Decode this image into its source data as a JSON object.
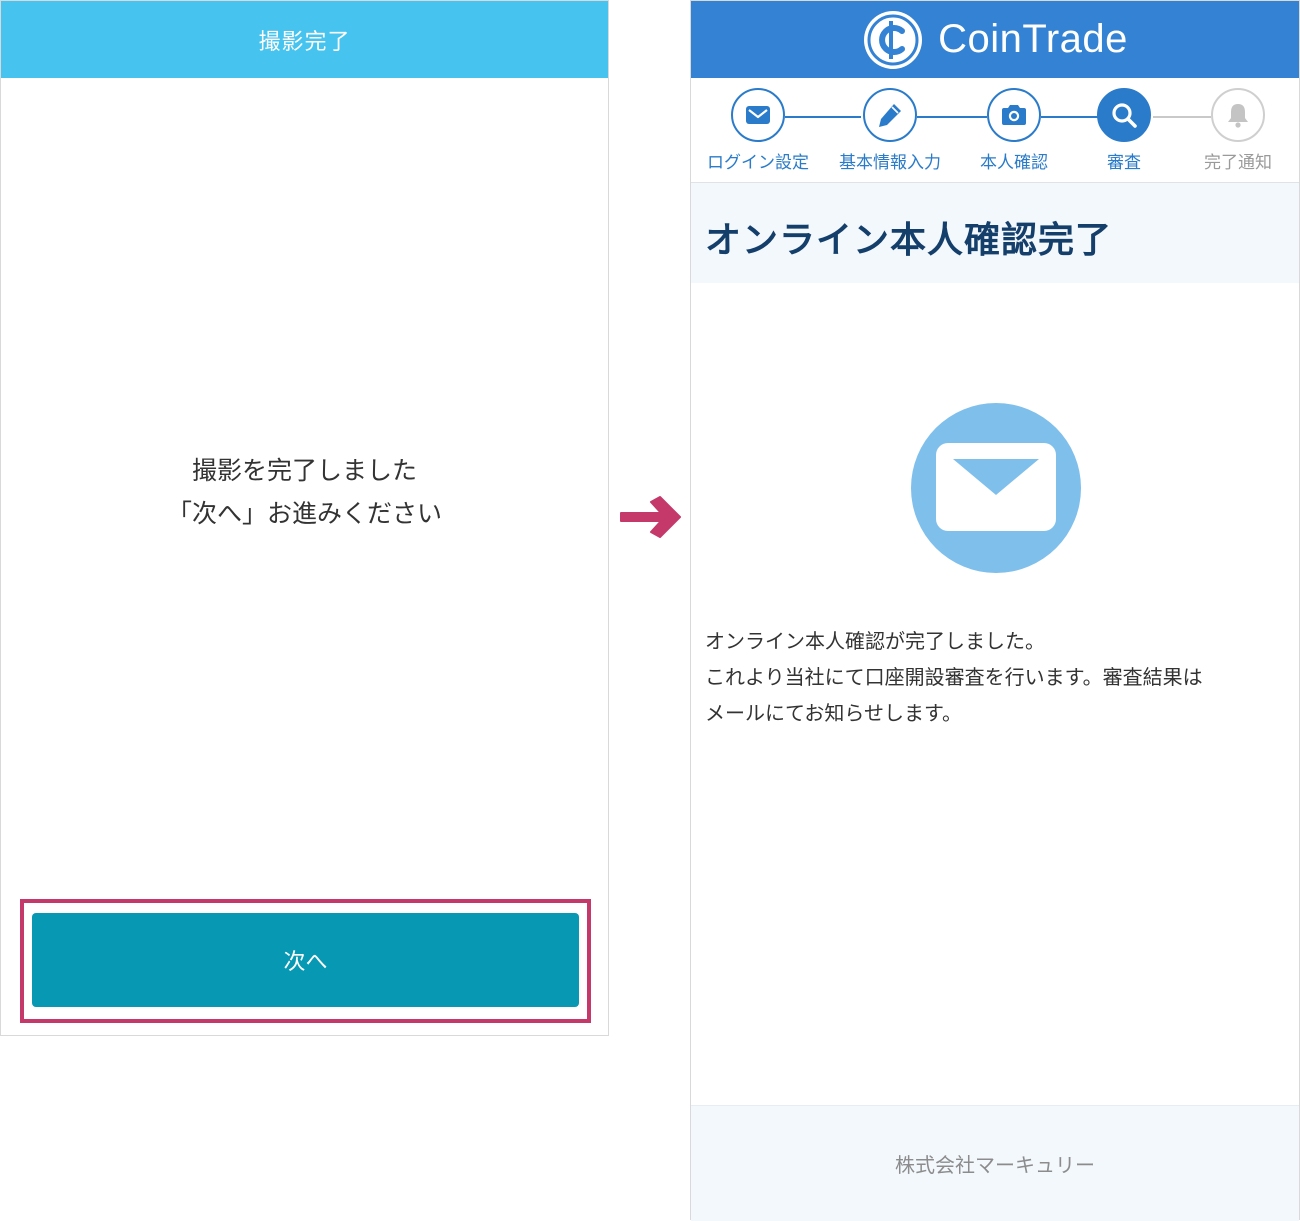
{
  "left_screen": {
    "header_title": "撮影完了",
    "message_line1": "撮影を完了しました",
    "message_line2": "「次へ」お進みください",
    "next_button_label": "次へ"
  },
  "right_screen": {
    "app_name": "CoinTrade",
    "logo_icon": "coin-c-logo-icon",
    "steps": [
      {
        "label": "ログイン設定",
        "icon": "mail-icon",
        "state": "completed"
      },
      {
        "label": "基本情報入力",
        "icon": "pencil-icon",
        "state": "completed"
      },
      {
        "label": "本人確認",
        "icon": "camera-icon",
        "state": "completed"
      },
      {
        "label": "審査",
        "icon": "search-icon",
        "state": "current"
      },
      {
        "label": "完了通知",
        "icon": "bell-icon",
        "state": "inactive"
      }
    ],
    "page_title": "オンライン本人確認完了",
    "body_line1": "オンライン本人確認が完了しました。",
    "body_line2": "これより当社にて口座開設審査を行います。審査結果は",
    "body_line3": "メールにてお知らせします。",
    "footer_text": "株式会社マーキュリー"
  },
  "colors": {
    "left_header": "#46c3ee",
    "next_button": "#0798b3",
    "highlight_frame": "#c4386a",
    "app_header": "#3482d4",
    "step_active": "#2a7bc9",
    "title_text": "#153f6b",
    "mail_circle": "#7fbfec"
  }
}
